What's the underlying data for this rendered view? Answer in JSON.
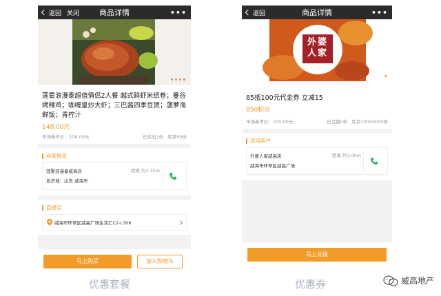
{
  "phoneA": {
    "navbar": {
      "back_label": "返回",
      "close_label": "关闭",
      "title": "商品详情",
      "more_label": "•••"
    },
    "product": {
      "title": "莲雾浪漫泰超值情侣2人餐 越式鲜虾米纸卷；曼谷烤辣鸡；咖喱皇炒大虾；三巴酱四季豆煲；菠萝海鲜饭；青柠汁",
      "price": "148.00元",
      "market_price": "市场参考价：208.00元",
      "sold": "已卖出1份",
      "stock": "库存99份"
    },
    "merchant_section": {
      "heading": "商家信息",
      "shop_name": "莲雾浪漫泰威海店",
      "distance": "距离 约3.1km",
      "ship_from": "发货地：山东 威海市"
    },
    "pickup_section": {
      "heading": "自提点",
      "address": "威海市环翠区威高广场生活汇C2-L306"
    },
    "buttons": {
      "buy": "马上购买",
      "cart": "加入购物车"
    },
    "caption": "优惠套餐"
  },
  "phoneB": {
    "navbar": {
      "back_label": "返回",
      "title": "商品详情",
      "more_label": "•••"
    },
    "product": {
      "title": "85抵100元代金券 立减15",
      "points": "850积分",
      "market_price": "市场参考价：100.00元",
      "redeemed": "已兑换0份",
      "stock": "库存10000000份"
    },
    "merchant_section": {
      "heading": "适用商户",
      "shop_name": "外婆人家威高店",
      "distance": "距离 约3.0km",
      "address": "威海市环翠区威高广场"
    },
    "logo_text": "外婆人家",
    "buttons": {
      "redeem": "马上兑换"
    },
    "caption": "优惠券"
  },
  "watermark": {
    "text": "威高地产"
  },
  "colors": {
    "accent": "#f29b27",
    "navbar": "#2b2b2b",
    "caption": "#aab4c0",
    "phone_icon": "#2db36b",
    "logo_red": "#a3222a"
  }
}
